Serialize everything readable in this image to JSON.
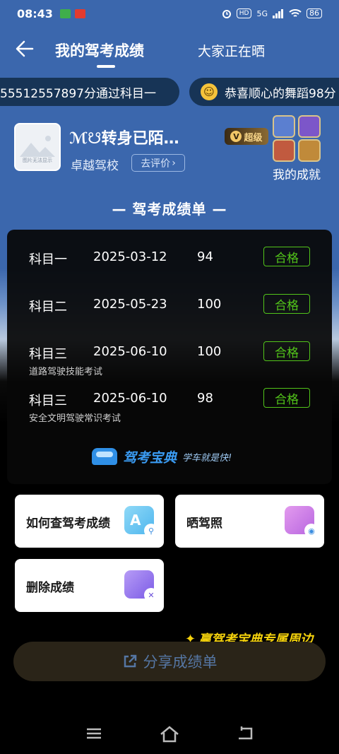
{
  "status_bar": {
    "time": "08:43",
    "hd": "HD",
    "net": "5G",
    "battery": "86"
  },
  "nav": {
    "active_tab": "我的驾考成绩",
    "other_tab": "大家正在晒"
  },
  "ticker": [
    {
      "text": "55512557897分通过科目一"
    },
    {
      "text": "恭喜顺心的舞蹈98分"
    }
  ],
  "profile": {
    "name": "ℳ☋转身已陌…",
    "school": "卓越驾校",
    "rate_label": "去评价",
    "vip_label": "超级",
    "vip_v": "V",
    "achievement_label": "我的成就",
    "avatar_caption": "图片无法显示"
  },
  "sheet_title": "— 驾考成绩单 —",
  "scores": [
    {
      "subject": "科目一",
      "date": "2025-03-12",
      "score": "94",
      "status": "合格",
      "note": ""
    },
    {
      "subject": "科目二",
      "date": "2025-05-23",
      "score": "100",
      "status": "合格",
      "note": ""
    },
    {
      "subject": "科目三",
      "date": "2025-06-10",
      "score": "100",
      "status": "合格",
      "note": "道路驾驶技能考试"
    },
    {
      "subject": "科目三",
      "date": "2025-06-10",
      "score": "98",
      "status": "合格",
      "note": "安全文明驾驶常识考试"
    }
  ],
  "brand": {
    "name": "驾考宝典",
    "slogan": "学车就是快!"
  },
  "actions": {
    "query": "如何查驾考成绩",
    "photo": "晒驾照",
    "delete": "删除成绩"
  },
  "promo": "赢驾考宝典专属周边",
  "share_label": "分享成绩单",
  "colors": {
    "header_blue": "#3b67ad",
    "pass_green": "#52c41a",
    "brand_blue": "#3a9bf2"
  }
}
